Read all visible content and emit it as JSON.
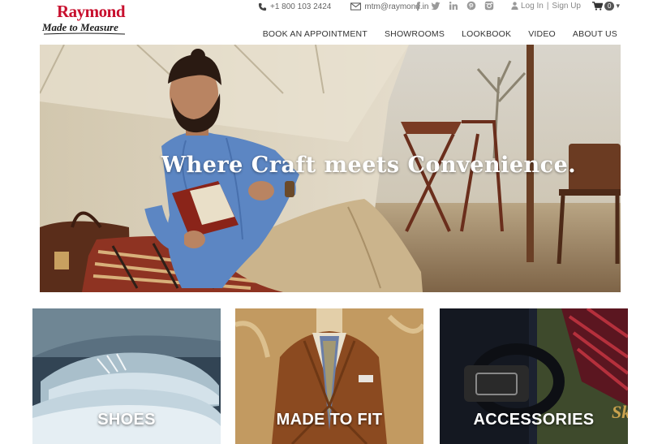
{
  "brand": {
    "name": "Raymond",
    "tagline": "Made to Measure",
    "color": "#c8102e"
  },
  "topbar": {
    "phone": "+1 800 103 2424",
    "phone_icon": "phone-icon",
    "email": "mtm@raymond.in",
    "email_icon": "mail-icon",
    "social_icons": [
      "facebook-icon",
      "twitter-icon",
      "linkedin-icon",
      "pinterest-icon",
      "instagram-icon"
    ],
    "login": "Log In",
    "divider": "|",
    "signup": "Sign Up",
    "cart_count": "0"
  },
  "nav": {
    "items": [
      "BOOK AN APPOINTMENT",
      "SHOWROOMS",
      "LOOKBOOK",
      "VIDEO",
      "ABOUT US"
    ]
  },
  "hero": {
    "headline": "Where Craft meets Convenience."
  },
  "categories": [
    {
      "label": "SHOES"
    },
    {
      "label": "MADE TO FIT"
    },
    {
      "label": "ACCESSORIES"
    }
  ]
}
